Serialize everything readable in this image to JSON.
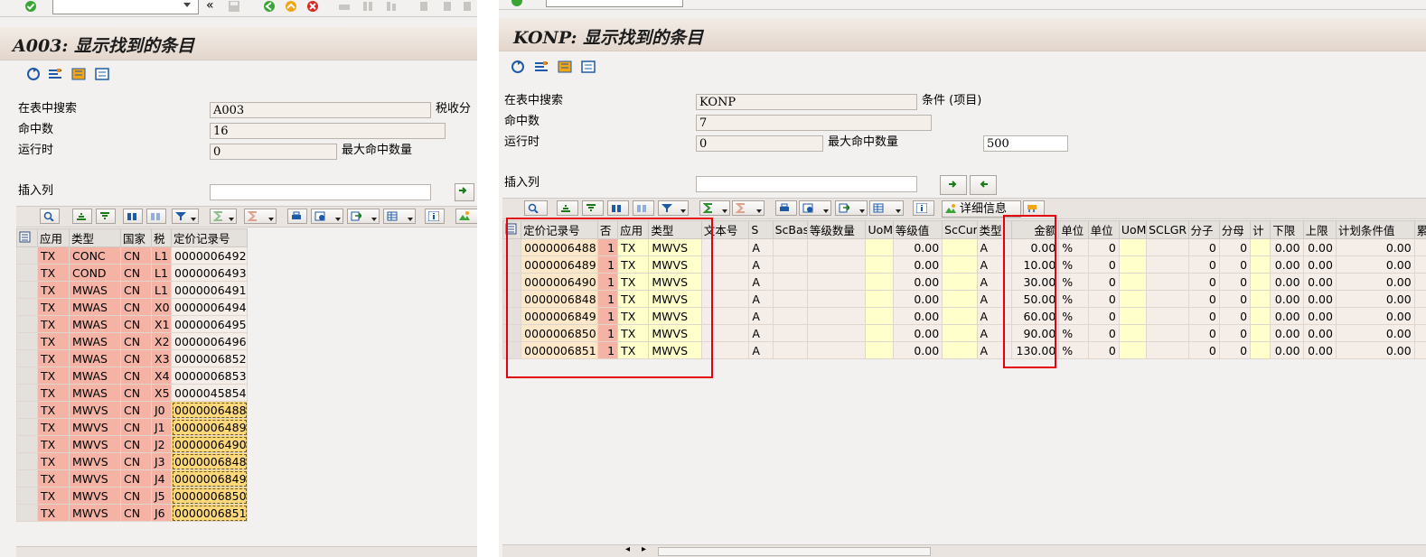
{
  "colors": {
    "key": "#f4b3a5",
    "yellow": "#ffffcc",
    "highlight": "#ffd87a",
    "red_box": "#e3000f"
  },
  "left": {
    "title": "A003: 显示找到的条目",
    "labels": {
      "search_in_table": "在表中搜索",
      "hit_count": "命中数",
      "runtime": "运行时",
      "max_hits": "最大命中数量",
      "insert_column": "插入列",
      "tax_class": "税收分"
    },
    "values": {
      "table": "A003",
      "hits": "16",
      "runtime": "0"
    },
    "columns": [
      "应用",
      "类型",
      "国家",
      "税",
      "定价记录号"
    ],
    "rows": [
      [
        "TX",
        "CONC",
        "CN",
        "L1",
        "0000006492"
      ],
      [
        "TX",
        "COND",
        "CN",
        "L1",
        "0000006493"
      ],
      [
        "TX",
        "MWAS",
        "CN",
        "L1",
        "0000006491"
      ],
      [
        "TX",
        "MWAS",
        "CN",
        "X0",
        "0000006494"
      ],
      [
        "TX",
        "MWAS",
        "CN",
        "X1",
        "0000006495"
      ],
      [
        "TX",
        "MWAS",
        "CN",
        "X2",
        "0000006496"
      ],
      [
        "TX",
        "MWAS",
        "CN",
        "X3",
        "0000006852"
      ],
      [
        "TX",
        "MWAS",
        "CN",
        "X4",
        "0000006853"
      ],
      [
        "TX",
        "MWAS",
        "CN",
        "X5",
        "0000045854"
      ],
      [
        "TX",
        "MWVS",
        "CN",
        "J0",
        "0000006488"
      ],
      [
        "TX",
        "MWVS",
        "CN",
        "J1",
        "0000006489"
      ],
      [
        "TX",
        "MWVS",
        "CN",
        "J2",
        "0000006490"
      ],
      [
        "TX",
        "MWVS",
        "CN",
        "J3",
        "0000006848"
      ],
      [
        "TX",
        "MWVS",
        "CN",
        "J4",
        "0000006849"
      ],
      [
        "TX",
        "MWVS",
        "CN",
        "J5",
        "0000006850"
      ],
      [
        "TX",
        "MWVS",
        "CN",
        "J6",
        "0000006851"
      ]
    ],
    "highlighted_from_row": 9
  },
  "right": {
    "title": "KONP: 显示找到的条目",
    "labels": {
      "search_in_table": "在表中搜索",
      "table_desc": "条件 (项目)",
      "hit_count": "命中数",
      "runtime": "运行时",
      "max_hits": "最大命中数量",
      "insert_column": "插入列",
      "details": "详细信息"
    },
    "values": {
      "table": "KONP",
      "hits": "7",
      "runtime": "0",
      "max_hits": "500"
    },
    "columns": [
      "定价记录号",
      "否",
      "应用",
      "类型",
      "文本号",
      "S",
      "ScBas",
      "等级数量",
      "UoM",
      "等级值",
      "ScCur",
      "类型",
      "金额",
      "单位",
      "单位",
      "UoM",
      "SCLGR",
      "分子",
      "分母",
      "计",
      "下限",
      "上限",
      "计划条件值",
      "累"
    ],
    "rows": [
      [
        "0000006488",
        "1",
        "TX",
        "MWVS",
        "",
        "A",
        "",
        "",
        "",
        "0.00",
        "",
        "A",
        "0.00",
        "%",
        "0",
        "",
        "",
        "0",
        "0",
        "",
        "0.00",
        "0.00",
        "0.00",
        ""
      ],
      [
        "0000006489",
        "1",
        "TX",
        "MWVS",
        "",
        "A",
        "",
        "",
        "",
        "0.00",
        "",
        "A",
        "10.00",
        "%",
        "0",
        "",
        "",
        "0",
        "0",
        "",
        "0.00",
        "0.00",
        "0.00",
        ""
      ],
      [
        "0000006490",
        "1",
        "TX",
        "MWVS",
        "",
        "A",
        "",
        "",
        "",
        "0.00",
        "",
        "A",
        "30.00",
        "%",
        "0",
        "",
        "",
        "0",
        "0",
        "",
        "0.00",
        "0.00",
        "0.00",
        ""
      ],
      [
        "0000006848",
        "1",
        "TX",
        "MWVS",
        "",
        "A",
        "",
        "",
        "",
        "0.00",
        "",
        "A",
        "50.00",
        "%",
        "0",
        "",
        "",
        "0",
        "0",
        "",
        "0.00",
        "0.00",
        "0.00",
        ""
      ],
      [
        "0000006849",
        "1",
        "TX",
        "MWVS",
        "",
        "A",
        "",
        "",
        "",
        "0.00",
        "",
        "A",
        "60.00",
        "%",
        "0",
        "",
        "",
        "0",
        "0",
        "",
        "0.00",
        "0.00",
        "0.00",
        ""
      ],
      [
        "0000006850",
        "1",
        "TX",
        "MWVS",
        "",
        "A",
        "",
        "",
        "",
        "0.00",
        "",
        "A",
        "90.00",
        "%",
        "0",
        "",
        "",
        "0",
        "0",
        "",
        "0.00",
        "0.00",
        "0.00",
        ""
      ],
      [
        "0000006851",
        "1",
        "TX",
        "MWVS",
        "",
        "A",
        "",
        "",
        "",
        "0.00",
        "",
        "A",
        "130.00",
        "%",
        "0",
        "",
        "",
        "0",
        "0",
        "",
        "0.00",
        "0.00",
        "0.00",
        ""
      ]
    ]
  }
}
